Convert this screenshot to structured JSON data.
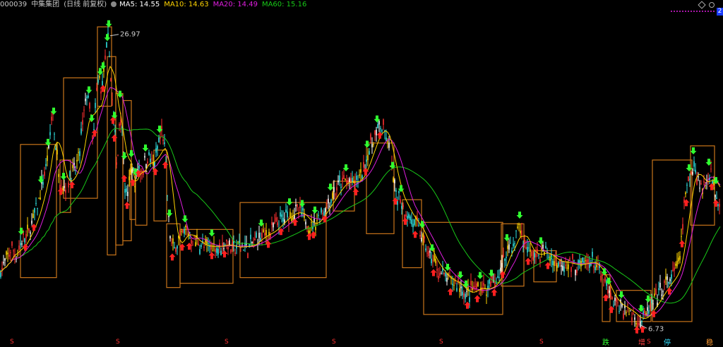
{
  "header": {
    "code": "000039",
    "name": "中集集团",
    "period": "(日线 前复权)",
    "indicators": [
      {
        "label": "MA5: 14.55",
        "color": "#ffffff"
      },
      {
        "label": "MA10: 14.63",
        "color": "#ffd400"
      },
      {
        "label": "MA20: 14.49",
        "color": "#e01ee0"
      },
      {
        "label": "MA60: 15.16",
        "color": "#18c818"
      }
    ]
  },
  "badge": "2",
  "bottom_labels": [
    {
      "text": "S",
      "color": "#ff3030"
    },
    {
      "text": "S",
      "color": "#ff3030"
    },
    {
      "text": "S",
      "color": "#ff3030"
    },
    {
      "text": "S",
      "color": "#ff3030"
    },
    {
      "text": "S",
      "color": "#ff3030"
    },
    {
      "text": "S",
      "color": "#ff3030"
    },
    {
      "text": "S",
      "color": "#ff3030"
    },
    {
      "text": "跌",
      "color": "#30ff30"
    },
    {
      "text": "增",
      "color": "#ff4040"
    },
    {
      "text": "S",
      "color": "#ff3030"
    },
    {
      "text": "停",
      "color": "#30e0ff"
    },
    {
      "text": "稳",
      "color": "#ff9a30"
    }
  ],
  "chart_data": {
    "type": "candlestick",
    "high_label": "26.97",
    "low_label": "6.73",
    "price_range": [
      5.5,
      28.5
    ],
    "close_path": [
      [
        0,
        10.3
      ],
      [
        8,
        11.0
      ],
      [
        16,
        12.0
      ],
      [
        24,
        11.5
      ],
      [
        32,
        12.6
      ],
      [
        40,
        13.0
      ],
      [
        48,
        14.2
      ],
      [
        56,
        15.5
      ],
      [
        64,
        17.4
      ],
      [
        70,
        19.2
      ],
      [
        74,
        22.0
      ],
      [
        78,
        19.6
      ],
      [
        84,
        17.0
      ],
      [
        90,
        16.2
      ],
      [
        98,
        17.0
      ],
      [
        106,
        17.4
      ],
      [
        112,
        18.5
      ],
      [
        118,
        21.2
      ],
      [
        124,
        23.2
      ],
      [
        128,
        21.4
      ],
      [
        132,
        19.2
      ],
      [
        136,
        22.5
      ],
      [
        140,
        24.2
      ],
      [
        144,
        23.0
      ],
      [
        148,
        25.0
      ],
      [
        152,
        26.0
      ],
      [
        154,
        26.97
      ],
      [
        158,
        23.0
      ],
      [
        162,
        20.5
      ],
      [
        166,
        17.5
      ],
      [
        170,
        22.0
      ],
      [
        174,
        19.8
      ],
      [
        178,
        15.5
      ],
      [
        182,
        16.0
      ],
      [
        186,
        17.8
      ],
      [
        192,
        16.5
      ],
      [
        196,
        18.0
      ],
      [
        200,
        17.2
      ],
      [
        206,
        18.2
      ],
      [
        212,
        18.5
      ],
      [
        218,
        17.6
      ],
      [
        224,
        19.2
      ],
      [
        230,
        20.2
      ],
      [
        234,
        18.6
      ],
      [
        238,
        14.8
      ],
      [
        242,
        12.4
      ],
      [
        246,
        11.8
      ],
      [
        252,
        12.5
      ],
      [
        258,
        12.8
      ],
      [
        264,
        13.4
      ],
      [
        270,
        12.6
      ],
      [
        280,
        12.4
      ],
      [
        290,
        12.0
      ],
      [
        300,
        12.2
      ],
      [
        310,
        12.0
      ],
      [
        320,
        12.4
      ],
      [
        330,
        11.9
      ],
      [
        340,
        12.2
      ],
      [
        350,
        12.0
      ],
      [
        360,
        12.4
      ],
      [
        370,
        12.9
      ],
      [
        380,
        13.0
      ],
      [
        390,
        13.5
      ],
      [
        400,
        14.0
      ],
      [
        410,
        14.4
      ],
      [
        420,
        14.6
      ],
      [
        430,
        14.2
      ],
      [
        440,
        13.4
      ],
      [
        450,
        14.1
      ],
      [
        460,
        14.8
      ],
      [
        470,
        15.6
      ],
      [
        480,
        16.4
      ],
      [
        490,
        16.8
      ],
      [
        500,
        16.5
      ],
      [
        510,
        17.0
      ],
      [
        516,
        17.8
      ],
      [
        522,
        18.8
      ],
      [
        530,
        19.8
      ],
      [
        538,
        20.7
      ],
      [
        546,
        20.0
      ],
      [
        552,
        18.5
      ],
      [
        558,
        16.2
      ],
      [
        566,
        15.6
      ],
      [
        572,
        14.8
      ],
      [
        580,
        14.1
      ],
      [
        590,
        13.6
      ],
      [
        598,
        12.8
      ],
      [
        606,
        11.6
      ],
      [
        614,
        11.0
      ],
      [
        622,
        10.3
      ],
      [
        630,
        9.9
      ],
      [
        640,
        9.6
      ],
      [
        650,
        9.4
      ],
      [
        660,
        8.6
      ],
      [
        670,
        9.1
      ],
      [
        680,
        9.2
      ],
      [
        690,
        9.0
      ],
      [
        700,
        9.6
      ],
      [
        710,
        10.5
      ],
      [
        716,
        11.6
      ],
      [
        722,
        12.4
      ],
      [
        728,
        12.0
      ],
      [
        734,
        13.9
      ],
      [
        740,
        12.6
      ],
      [
        748,
        11.8
      ],
      [
        756,
        11.4
      ],
      [
        764,
        11.6
      ],
      [
        772,
        11.8
      ],
      [
        780,
        11.2
      ],
      [
        790,
        11.0
      ],
      [
        800,
        11.0
      ],
      [
        810,
        10.8
      ],
      [
        820,
        10.8
      ],
      [
        830,
        11.0
      ],
      [
        840,
        11.0
      ],
      [
        848,
        10.4
      ],
      [
        854,
        9.7
      ],
      [
        860,
        9.0
      ],
      [
        868,
        8.2
      ],
      [
        878,
        7.9
      ],
      [
        888,
        7.6
      ],
      [
        898,
        7.2
      ],
      [
        906,
        6.73
      ],
      [
        914,
        7.3
      ],
      [
        922,
        7.8
      ],
      [
        930,
        8.4
      ],
      [
        940,
        9.3
      ],
      [
        950,
        9.8
      ],
      [
        958,
        10.5
      ],
      [
        964,
        11.8
      ],
      [
        970,
        15.5
      ],
      [
        976,
        16.8
      ],
      [
        982,
        18.0
      ],
      [
        988,
        17.0
      ],
      [
        994,
        16.2
      ],
      [
        1000,
        16.6
      ],
      [
        1006,
        17.5
      ],
      [
        1012,
        16.2
      ],
      [
        1018,
        15.3
      ]
    ],
    "moving_averages": [
      {
        "name": "MA60",
        "color": "#18c818"
      },
      {
        "name": "MA20",
        "color": "#e01ee0"
      },
      {
        "name": "MA10",
        "color": "#ffd400"
      }
    ],
    "box_color": "#c8741a",
    "boxes": [
      {
        "x": [
          29,
          80
        ],
        "y": [
          9.9,
          19.3
        ]
      },
      {
        "x": [
          85,
          100
        ],
        "y": [
          14.5,
          18.2
        ]
      },
      {
        "x": [
          90,
          138
        ],
        "y": [
          15.5,
          24.0
        ]
      },
      {
        "x": [
          138,
          158
        ],
        "y": [
          22.0,
          27.6
        ]
      },
      {
        "x": [
          152,
          164
        ],
        "y": [
          11.5,
          25.5
        ]
      },
      {
        "x": [
          164,
          174
        ],
        "y": [
          12.2,
          22.9
        ]
      },
      {
        "x": [
          174,
          186
        ],
        "y": [
          12.5,
          22.4
        ]
      },
      {
        "x": [
          184,
          192
        ],
        "y": [
          14.0,
          17.6
        ]
      },
      {
        "x": [
          192,
          208
        ],
        "y": [
          13.6,
          17.4
        ]
      },
      {
        "x": [
          218,
          236
        ],
        "y": [
          13.9,
          18.9
        ]
      },
      {
        "x": [
          236,
          255
        ],
        "y": [
          9.2,
          13.7
        ]
      },
      {
        "x": [
          255,
          330
        ],
        "y": [
          9.5,
          13.3
        ]
      },
      {
        "x": [
          340,
          462
        ],
        "y": [
          9.9,
          15.2
        ]
      },
      {
        "x": [
          472,
          502
        ],
        "y": [
          14.6,
          16.7
        ]
      },
      {
        "x": [
          519,
          558
        ],
        "y": [
          13.0,
          19.4
        ]
      },
      {
        "x": [
          570,
          597
        ],
        "y": [
          10.6,
          15.4
        ]
      },
      {
        "x": [
          600,
          712
        ],
        "y": [
          7.3,
          13.8
        ]
      },
      {
        "x": [
          710,
          742
        ],
        "y": [
          9.3,
          13.7
        ]
      },
      {
        "x": [
          756,
          788
        ],
        "y": [
          9.6,
          11.8
        ]
      },
      {
        "x": [
          853,
          864
        ],
        "y": [
          6.8,
          10.1
        ]
      },
      {
        "x": [
          873,
          922
        ],
        "y": [
          6.8,
          9.0
        ]
      },
      {
        "x": [
          924,
          980
        ],
        "y": [
          6.8,
          18.2
        ]
      },
      {
        "x": [
          978,
          1012
        ],
        "y": [
          13.6,
          19.2
        ]
      }
    ],
    "down_arrows_x": [
      30,
      58,
      68,
      76,
      90,
      126,
      130,
      142,
      146,
      152,
      154,
      162,
      170,
      176,
      186,
      192,
      206,
      226,
      240,
      262,
      300,
      370,
      410,
      428,
      446,
      468,
      490,
      520,
      534,
      556,
      568,
      598,
      612,
      634,
      652,
      660,
      680,
      696,
      718,
      736,
      766,
      856,
      862,
      880,
      908,
      918,
      976,
      982,
      1004,
      1014
    ],
    "up_arrows_x": [
      36,
      48,
      86,
      102,
      134,
      146,
      160,
      162,
      176,
      180,
      188,
      196,
      220,
      234,
      244,
      258,
      268,
      300,
      318,
      380,
      398,
      418,
      438,
      444,
      460,
      504,
      518,
      538,
      560,
      574,
      588,
      614,
      638,
      662,
      676,
      700,
      712,
      748,
      776,
      858,
      866,
      902,
      910,
      926,
      948,
      966,
      972,
      1008,
      1014
    ]
  }
}
